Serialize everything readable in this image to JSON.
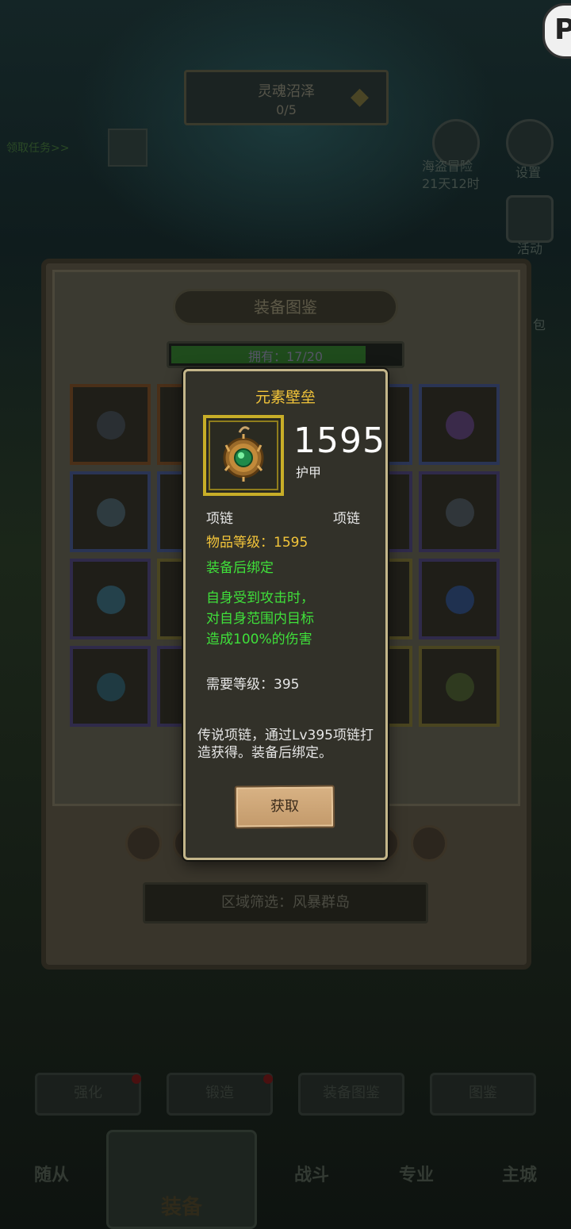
{
  "background": {
    "quest": {
      "title": "灵魂沼泽",
      "progress": "0/5",
      "link": "领取任务>>"
    },
    "top_right": {
      "event_name": "海盗冒险",
      "event_timer": "21天12时",
      "settings_label": "设置",
      "activity_label": "活动",
      "pack_label": "包"
    },
    "bottom_buttons": [
      {
        "label": "强化",
        "has_alert": true
      },
      {
        "label": "锻造",
        "has_alert": true
      },
      {
        "label": "装备图鉴",
        "has_alert": false
      },
      {
        "label": "图鉴",
        "has_alert": false
      }
    ],
    "nav": {
      "items": [
        "随从",
        "装备",
        "战斗",
        "专业",
        "主城"
      ],
      "active": "装备"
    }
  },
  "codex": {
    "title": "装备图鉴",
    "owned_label": "拥有：17/20",
    "owned_progress": 0.85,
    "region_filter": "区域筛选：风暴群岛"
  },
  "tooltip": {
    "name": "元素壁垒",
    "stat_value": "1595",
    "stat_name": "护甲",
    "slot_type": "项链",
    "item_type": "项链",
    "item_level": "物品等级：1595",
    "bind": "装备后绑定",
    "effect": [
      "自身受到攻击时，",
      "对自身范围内目标",
      "造成100%的伤害"
    ],
    "required_level": "需要等级：395",
    "description": "传说项链，通过Lv395项链打造获得。装备后绑定。",
    "get_button": "获取"
  },
  "colors": {
    "item_name": "#f3c53a",
    "bind_green": "#3fe13a",
    "frame_gold": "#c8ae28",
    "tooltip_border": "#c4b68a"
  }
}
